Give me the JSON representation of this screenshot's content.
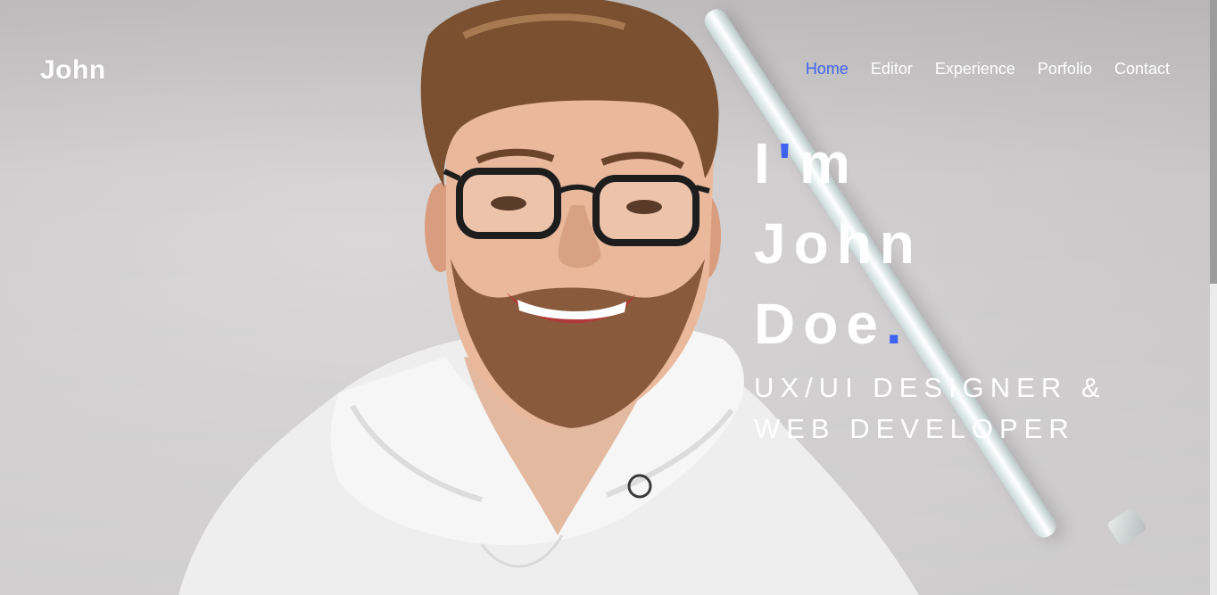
{
  "header": {
    "logo": "John",
    "nav": [
      {
        "label": "Home",
        "active": true
      },
      {
        "label": "Editor",
        "active": false
      },
      {
        "label": "Experience",
        "active": false
      },
      {
        "label": "Porfolio",
        "active": false
      },
      {
        "label": "Contact",
        "active": false
      }
    ]
  },
  "hero": {
    "line1_a": "I",
    "line1_accent": "'",
    "line1_b": "m",
    "line2": "John",
    "line3": "Doe",
    "line3_accent": ".",
    "subtitle": "UX/UI DESIGNER & WEB DEVELOPER"
  },
  "colors": {
    "accent": "#3f63f0",
    "text": "#ffffff"
  },
  "icons": {
    "hero_photo": "smiling-man-with-glasses-photo"
  }
}
